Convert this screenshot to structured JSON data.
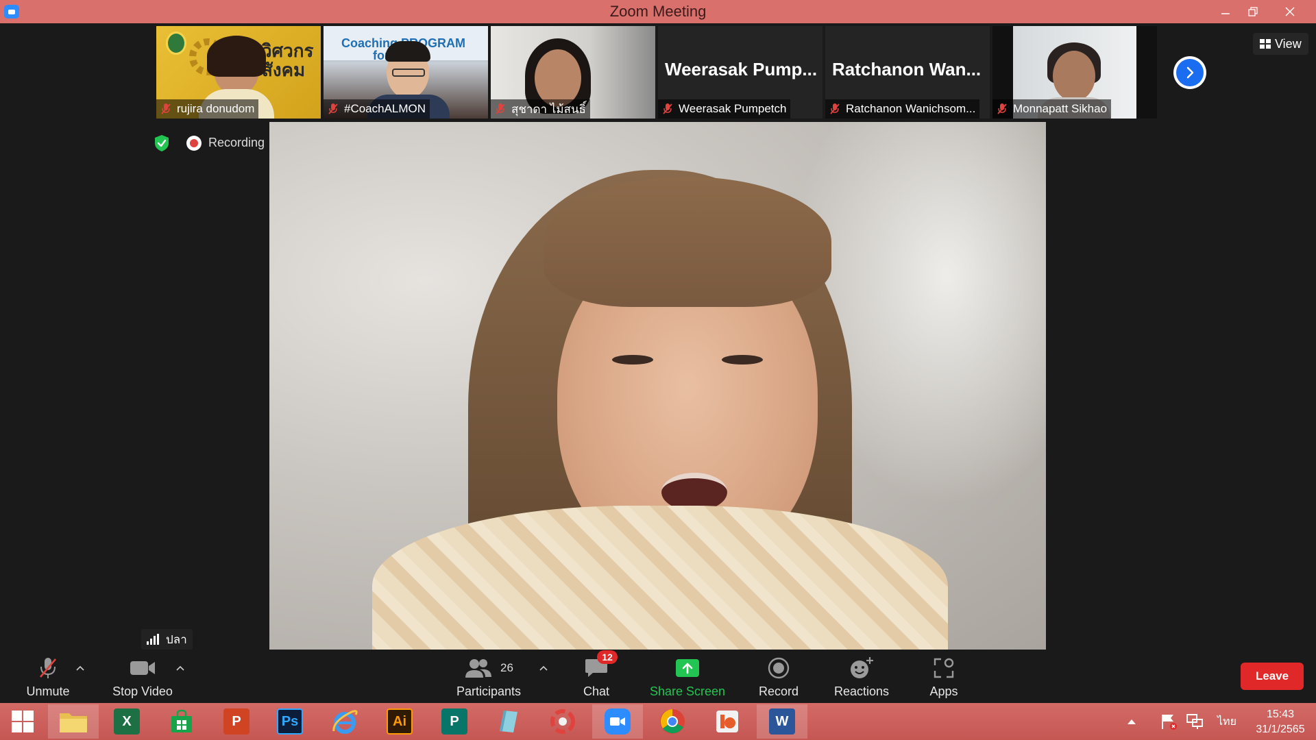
{
  "window": {
    "title": "Zoom Meeting"
  },
  "participants_strip": [
    {
      "name": "rujira donudom",
      "muted": true,
      "type": "video"
    },
    {
      "name": "#CoachALMON",
      "muted": true,
      "type": "video"
    },
    {
      "name": "สุชาดา ไม้สนธิ์",
      "muted": true,
      "type": "video"
    },
    {
      "name": "Weerasak Pumpetch",
      "display_name": "Weerasak Pump...",
      "muted": true,
      "type": "name"
    },
    {
      "name": "Ratchanon Wanichsom...",
      "display_name": "Ratchanon Wan...",
      "muted": true,
      "type": "name"
    },
    {
      "name": "Monnapatt Sikhao",
      "muted": true,
      "type": "video"
    }
  ],
  "tile_texts": {
    "coach_banner": "Coaching PROGRAM",
    "coach_sub": "for",
    "thai_banner_1": "วิศวกร",
    "thai_banner_2": "สังคม"
  },
  "view_button": "View",
  "recording": {
    "label": "Recording"
  },
  "network": {
    "label": "ปลา"
  },
  "toolbar": {
    "unmute": "Unmute",
    "stop_video": "Stop Video",
    "participants": "Participants",
    "participant_count": "26",
    "chat": "Chat",
    "chat_badge": "12",
    "share_screen": "Share Screen",
    "record": "Record",
    "reactions": "Reactions",
    "apps": "Apps",
    "leave": "Leave"
  },
  "taskbar": {
    "language": "ไทย",
    "time": "15:43",
    "date": "31/1/2565",
    "apps": [
      "Start",
      "File Explorer",
      "Excel",
      "Store",
      "PowerPoint",
      "Photoshop",
      "Internet Explorer",
      "Illustrator",
      "Publisher",
      "Notes",
      "PhotoScape",
      "Zoom",
      "Chrome",
      "Office",
      "Word"
    ],
    "app_glyphs": {
      "excel": "X",
      "powerpoint": "P",
      "photoshop": "Ps",
      "illustrator": "Ai",
      "publisher": "P",
      "word": "W"
    }
  },
  "colors": {
    "titlebar": "#d9706c",
    "leave": "#e02828",
    "share_green": "#23c552",
    "badge_red": "#e02828",
    "muted_mic": "#e0433d",
    "next_blue": "#1a6cf0"
  }
}
